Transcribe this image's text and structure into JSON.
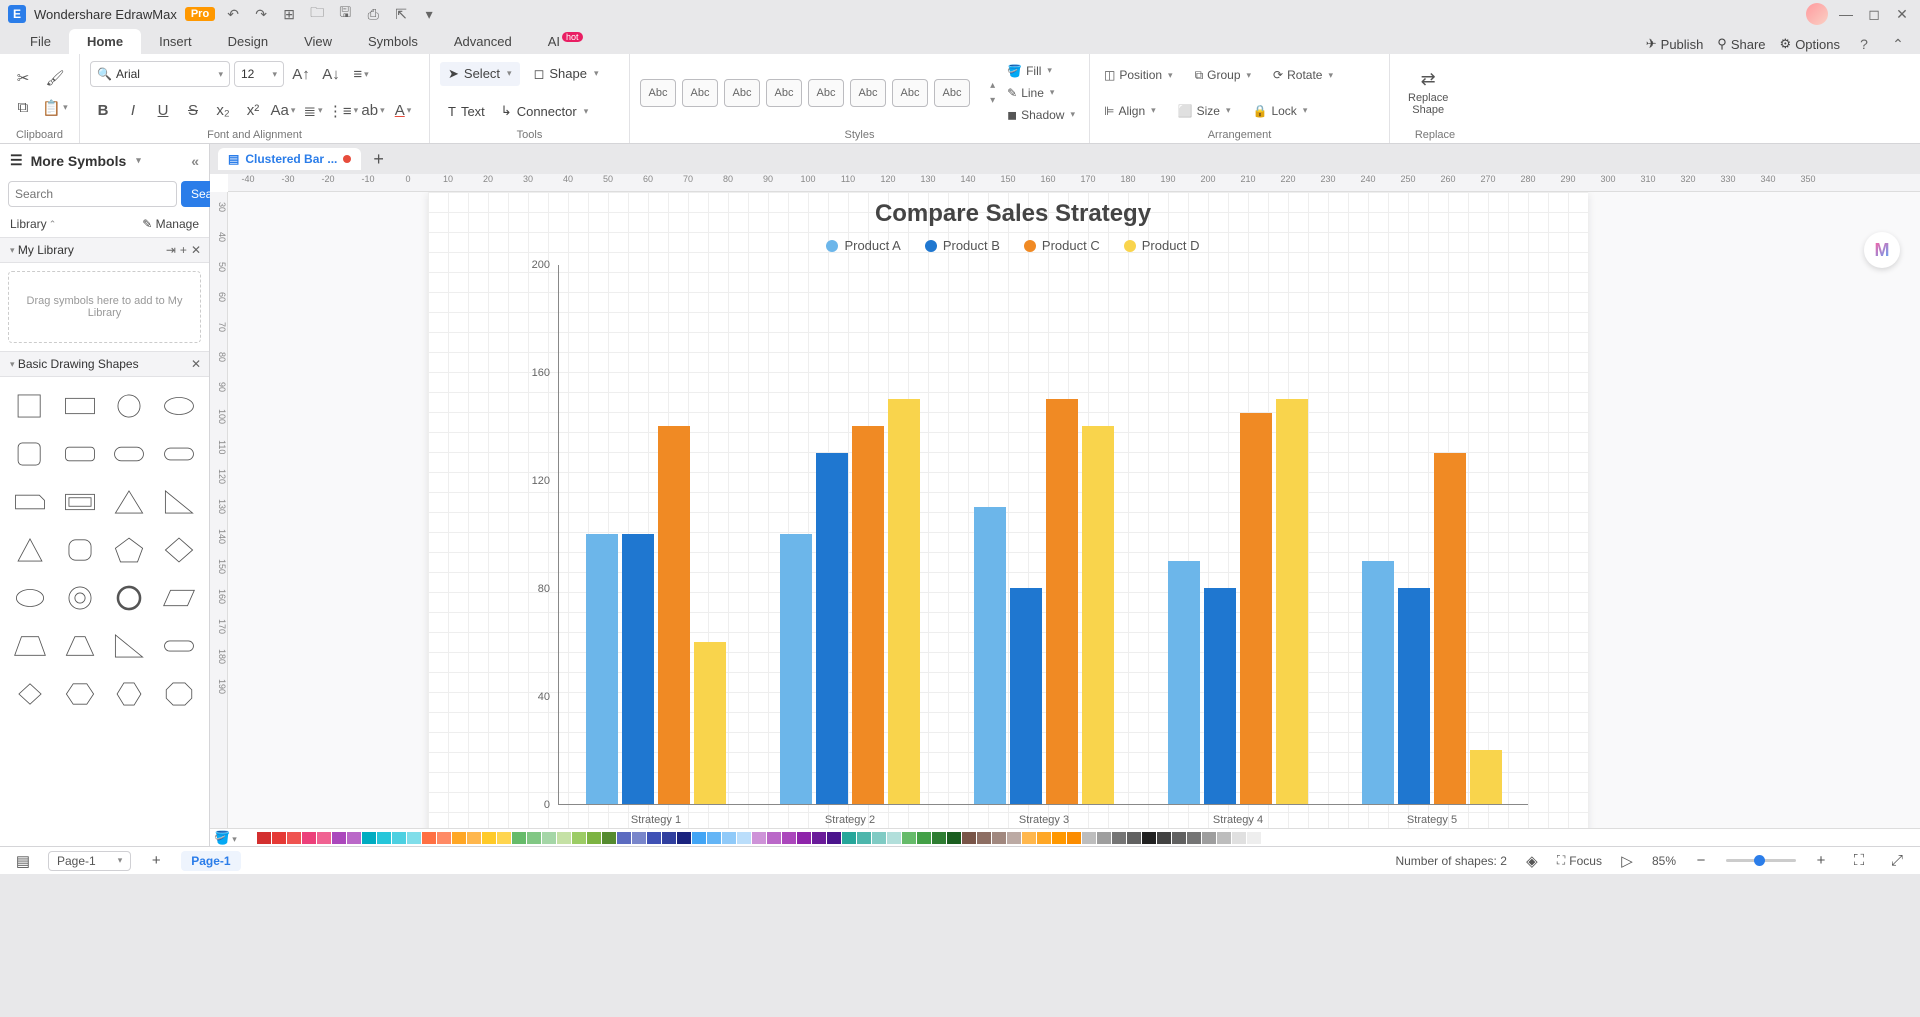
{
  "app": {
    "title": "Wondershare EdrawMax",
    "badge": "Pro"
  },
  "menubar": {
    "items": [
      "File",
      "Home",
      "Insert",
      "Design",
      "View",
      "Symbols",
      "Advanced",
      "AI"
    ],
    "active": "Home",
    "ai_badge": "hot",
    "right": {
      "publish": "Publish",
      "share": "Share",
      "options": "Options"
    }
  },
  "ribbon": {
    "font_name": "Arial",
    "font_size": "12",
    "select": "Select",
    "shape": "Shape",
    "text": "Text",
    "connector": "Connector",
    "style_label": "Abc",
    "fill": "Fill",
    "line": "Line",
    "shadow": "Shadow",
    "position": "Position",
    "group": "Group",
    "rotate": "Rotate",
    "align": "Align",
    "size": "Size",
    "lock": "Lock",
    "replace_shape": "Replace\nShape",
    "groups": {
      "clipboard": "Clipboard",
      "font": "Font and Alignment",
      "tools": "Tools",
      "styles": "Styles",
      "arrangement": "Arrangement",
      "replace": "Replace"
    }
  },
  "left_panel": {
    "header": "More Symbols",
    "search_placeholder": "Search",
    "search_btn": "Search",
    "library": "Library",
    "manage": "Manage",
    "my_library": "My Library",
    "drop_hint": "Drag symbols here to add to My Library",
    "basic_shapes": "Basic Drawing Shapes"
  },
  "doc_tab": "Clustered Bar ...",
  "ruler_h": [
    "-40",
    "-30",
    "-20",
    "-10",
    "0",
    "10",
    "20",
    "30",
    "40",
    "50",
    "60",
    "70",
    "80",
    "90",
    "100",
    "110",
    "120",
    "130",
    "140",
    "150",
    "160",
    "170",
    "180",
    "190",
    "200",
    "210",
    "220",
    "230",
    "240",
    "250",
    "260",
    "270",
    "280",
    "290",
    "300",
    "310",
    "320",
    "330",
    "340",
    "350"
  ],
  "ruler_v": [
    "30",
    "40",
    "50",
    "60",
    "70",
    "80",
    "90",
    "100",
    "110",
    "120",
    "130",
    "140",
    "150",
    "160",
    "170",
    "180",
    "190"
  ],
  "chart_data": {
    "type": "bar",
    "title": "Compare Sales Strategy",
    "categories": [
      "Strategy 1",
      "Strategy 2",
      "Strategy 3",
      "Strategy 4",
      "Strategy 5"
    ],
    "series": [
      {
        "name": "Product A",
        "color": "#6cb6ea",
        "values": [
          100,
          100,
          110,
          90,
          90
        ]
      },
      {
        "name": "Product B",
        "color": "#1f77d0",
        "values": [
          100,
          130,
          80,
          80,
          80
        ]
      },
      {
        "name": "Product C",
        "color": "#f08a24",
        "values": [
          140,
          140,
          150,
          145,
          130
        ]
      },
      {
        "name": "Product D",
        "color": "#f9d44c",
        "values": [
          60,
          150,
          140,
          150,
          20
        ]
      }
    ],
    "ylim": [
      0,
      200
    ],
    "yticks": [
      0,
      40,
      80,
      120,
      160,
      200
    ],
    "xlabel": "",
    "ylabel": ""
  },
  "color_bar": [
    "#ffffff",
    "#d32f2f",
    "#e53935",
    "#ef5350",
    "#ec407a",
    "#f06292",
    "#ab47bc",
    "#ba68c8",
    "#00acc1",
    "#26c6da",
    "#4dd0e1",
    "#80deea",
    "#ff7043",
    "#ff8a65",
    "#ffa726",
    "#ffb74d",
    "#ffca28",
    "#ffd54f",
    "#66bb6a",
    "#81c784",
    "#a5d6a7",
    "#c5e1a5",
    "#9ccc65",
    "#7cb342",
    "#558b2f",
    "#5c6bc0",
    "#7986cb",
    "#3f51b5",
    "#303f9f",
    "#1a237e",
    "#42a5f5",
    "#64b5f6",
    "#90caf9",
    "#bbdefb",
    "#ce93d8",
    "#ba68c8",
    "#ab47bc",
    "#8e24aa",
    "#6a1b9a",
    "#4a148c",
    "#26a69a",
    "#4db6ac",
    "#80cbc4",
    "#b2dfdb",
    "#66bb6a",
    "#43a047",
    "#2e7d32",
    "#1b5e20",
    "#795548",
    "#8d6e63",
    "#a1887f",
    "#bcaaa4",
    "#ffb74d",
    "#ffa726",
    "#ff9800",
    "#fb8c00",
    "#bdbdbd",
    "#9e9e9e",
    "#757575",
    "#616161",
    "#212121",
    "#424242",
    "#616161",
    "#757575",
    "#9e9e9e",
    "#bdbdbd",
    "#e0e0e0",
    "#eeeeee"
  ],
  "statusbar": {
    "page_sel": "Page-1",
    "page_tab": "Page-1",
    "shapes": "Number of shapes: 2",
    "focus": "Focus",
    "zoom": "85%"
  }
}
